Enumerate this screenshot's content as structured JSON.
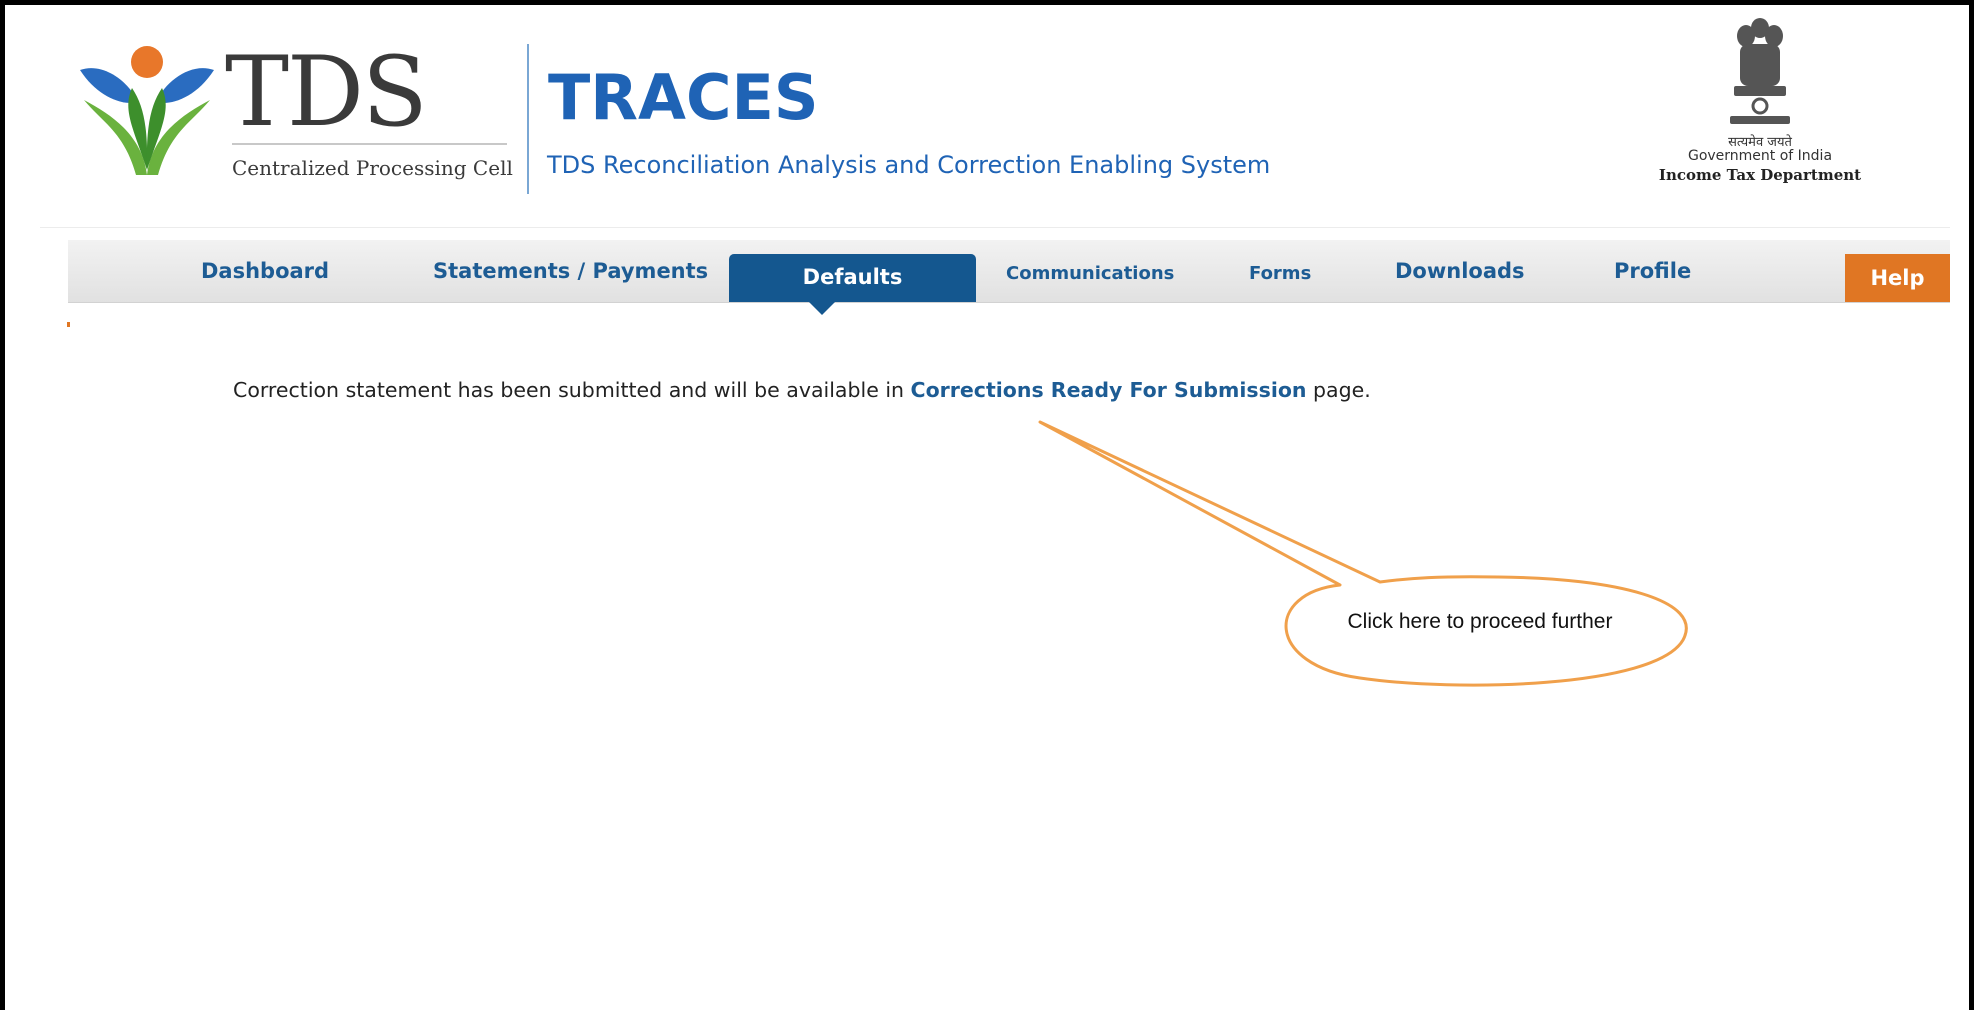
{
  "header": {
    "tds_logo_text": "TDS",
    "tds_logo_subtitle": "Centralized Processing Cell",
    "app_title": "TRACES",
    "app_subtitle": "TDS Reconciliation Analysis and Correction Enabling System",
    "gov_hindi": "सत्यमेव जयते",
    "gov_line": "Government of India",
    "dept_line": "Income Tax Department"
  },
  "nav": {
    "items": [
      {
        "label": "Dashboard"
      },
      {
        "label": "Statements / Payments"
      },
      {
        "label": "Defaults",
        "active": true
      },
      {
        "label": "Communications"
      },
      {
        "label": "Forms"
      },
      {
        "label": "Downloads"
      },
      {
        "label": "Profile"
      }
    ],
    "help_label": "Help",
    "colors": {
      "link": "#1d5c94",
      "active_bg": "#14578f",
      "help_bg": "#e07623"
    }
  },
  "main": {
    "message_before": "Correction statement has been submitted and will be available in ",
    "message_link": "Corrections Ready For Submission",
    "message_after": " page."
  },
  "callout": {
    "text": "Click here to proceed further",
    "outline_color": "#f0a04b"
  }
}
